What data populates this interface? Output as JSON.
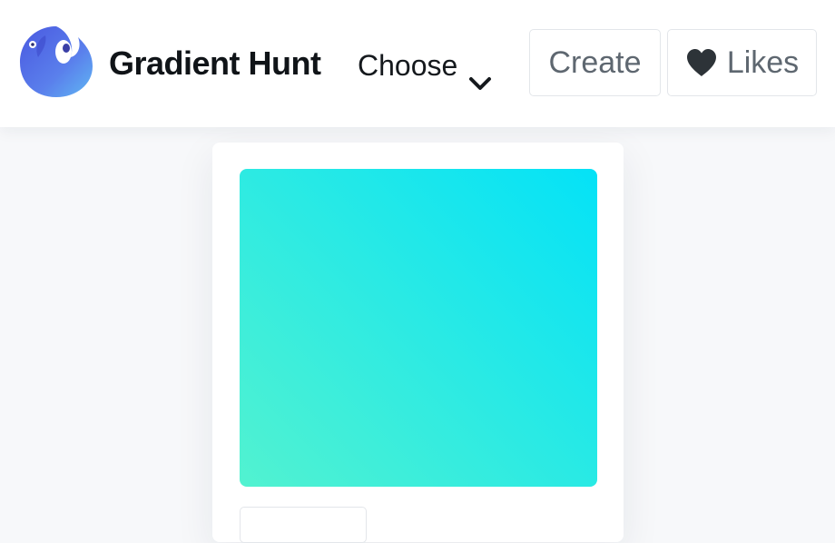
{
  "header": {
    "brand": "Gradient Hunt",
    "logo_icon": "bird-logo-icon",
    "nav": {
      "choose_label": "Choose",
      "choose_icon": "chevron-down-icon"
    },
    "buttons": {
      "create_label": "Create",
      "likes_label": "Likes",
      "likes_icon": "heart-icon"
    }
  },
  "gradient_card": {
    "colors": {
      "start": "#52f2d0",
      "end": "#04e2f7"
    }
  },
  "theme": {
    "text_dark": "#15191d",
    "button_text": "#5e6770",
    "heart_color": "#2d3338",
    "logo_blue": "#5b63e6",
    "logo_light": "#60a5f1"
  }
}
